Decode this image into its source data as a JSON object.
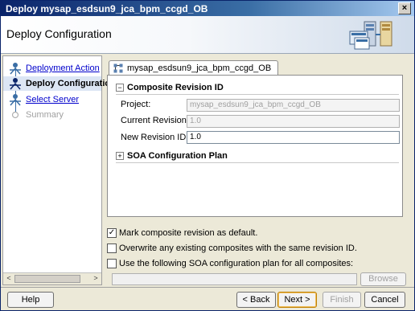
{
  "window": {
    "title": "Deploy mysap_esdsun9_jca_bpm_ccgd_OB",
    "close_glyph": "×"
  },
  "header": {
    "title": "Deploy Configuration",
    "graphic": "deploy-server-graphic"
  },
  "nav": {
    "items": [
      {
        "label": "Deployment Action",
        "state": "link"
      },
      {
        "label": "Deploy Configuration",
        "state": "active"
      },
      {
        "label": "Select Server",
        "state": "link"
      },
      {
        "label": "Summary",
        "state": "disabled"
      }
    ],
    "scroll_left": "<",
    "scroll_right": ">"
  },
  "tab": {
    "label": "mysap_esdsun9_jca_bpm_ccgd_OB",
    "icon": "composite-icon"
  },
  "composite_revision": {
    "title": "Composite Revision ID",
    "toggle": "−",
    "project_label": "Project:",
    "project_value": "mysap_esdsun9_jca_bpm_ccgd_OB",
    "current_label": "Current Revision ID:",
    "current_value": "1.0",
    "new_label": "New Revision ID:",
    "new_value": "1.0"
  },
  "soa_plan": {
    "title": "SOA Configuration Plan",
    "toggle": "+"
  },
  "options": [
    {
      "label": "Mark composite revision as default.",
      "checked": true
    },
    {
      "label": "Overwrite any existing composites with the same revision ID.",
      "checked": false
    },
    {
      "label": "Use the following SOA configuration plan for all composites:",
      "checked": false
    }
  ],
  "checkmark": "✓",
  "buttons": {
    "browse": "Browse",
    "help": "Help",
    "back": "< Back",
    "next": "Next >",
    "finish": "Finish",
    "cancel": "Cancel"
  },
  "colors": {
    "accent": "#0a246a",
    "link": "#0000cc",
    "active_step_bg": "#dce6f4"
  }
}
